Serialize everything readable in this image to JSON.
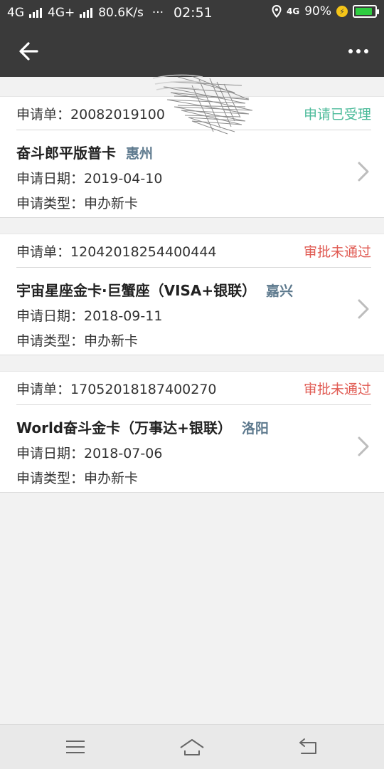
{
  "status_bar": {
    "net1": "4G",
    "net2": "4G+",
    "speed": "80.6K/s",
    "dots": "···",
    "time": "02:51",
    "net3": "4G",
    "battery": "90%"
  },
  "applications": [
    {
      "label": "申请单：",
      "number": "20082019100",
      "status": "申请已受理",
      "card_name": "奋斗郎平版普卡",
      "city": "惠州",
      "date_line": "申请日期：2019-04-10",
      "type_line": "申请类型：申办新卡"
    },
    {
      "label": "申请单：",
      "number": "12042018254400444",
      "status": "审批未通过",
      "card_name": "宇宙星座金卡·巨蟹座（VISA+银联）",
      "city": "嘉兴",
      "date_line": "申请日期：2018-09-11",
      "type_line": "申请类型：申办新卡"
    },
    {
      "label": "申请单：",
      "number": "17052018187400270",
      "status": "审批未通过",
      "card_name": "World奋斗金卡（万事达+银联）",
      "city": "洛阳",
      "date_line": "申请日期：2018-07-06",
      "type_line": "申请类型：申办新卡"
    }
  ],
  "colors": {
    "header": "#3a3a3a",
    "status_ok": "#4cbb9a",
    "status_bad": "#e05a52",
    "city": "#5e7a8e"
  },
  "icons": {
    "back": "arrow-left",
    "more": "three-dots",
    "chevron": "chevron-right",
    "nav_menu": "hamburger",
    "nav_home": "home",
    "nav_back": "return"
  }
}
